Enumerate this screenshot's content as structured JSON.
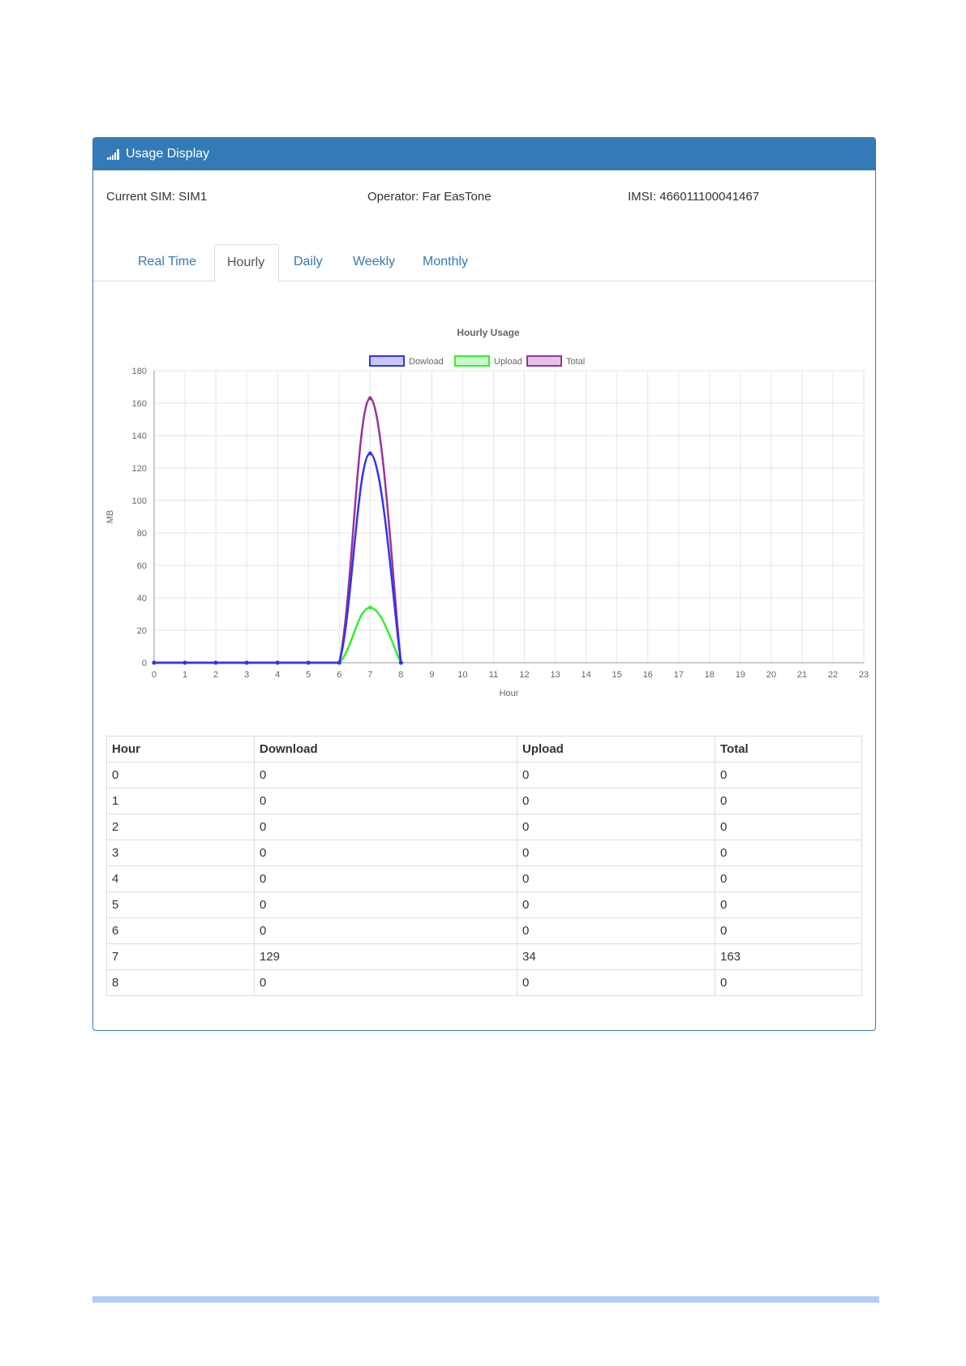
{
  "panel": {
    "title": "Usage Display",
    "icon": "signal-bars-icon",
    "current_sim": "Current SIM: SIM1",
    "operator": "Operator: Far EasTone",
    "imsi": "IMSI: 466011100041467"
  },
  "tabs": [
    {
      "label": "Real Time",
      "active": false
    },
    {
      "label": "Hourly",
      "active": true
    },
    {
      "label": "Daily",
      "active": false
    },
    {
      "label": "Weekly",
      "active": false
    },
    {
      "label": "Monthly",
      "active": false
    }
  ],
  "chart_data": {
    "type": "line",
    "title": "Hourly Usage",
    "xlabel": "Hour",
    "ylabel": "MB",
    "ylim": [
      0,
      180
    ],
    "yticks": [
      0,
      20,
      40,
      60,
      80,
      100,
      120,
      140,
      160,
      180
    ],
    "x": [
      0,
      1,
      2,
      3,
      4,
      5,
      6,
      7,
      8,
      9,
      10,
      11,
      12,
      13,
      14,
      15,
      16,
      17,
      18,
      19,
      20,
      21,
      22,
      23
    ],
    "legend_position": "top",
    "grid": true,
    "series": [
      {
        "name": "Dowload",
        "color": "#3333ee",
        "fill": "#c8c8f8",
        "values": [
          0,
          0,
          0,
          0,
          0,
          0,
          0,
          129,
          0
        ]
      },
      {
        "name": "Upload",
        "color": "#33ee33",
        "fill": "#c8f8c8",
        "values": [
          0,
          0,
          0,
          0,
          0,
          0,
          0,
          34,
          0
        ]
      },
      {
        "name": "Total",
        "color": "#993399",
        "fill": "#e6c3e6",
        "values": [
          0,
          0,
          0,
          0,
          0,
          0,
          0,
          163,
          0
        ]
      }
    ]
  },
  "table": {
    "headers": [
      "Hour",
      "Download",
      "Upload",
      "Total"
    ],
    "rows": [
      [
        "0",
        "0",
        "0",
        "0"
      ],
      [
        "1",
        "0",
        "0",
        "0"
      ],
      [
        "2",
        "0",
        "0",
        "0"
      ],
      [
        "3",
        "0",
        "0",
        "0"
      ],
      [
        "4",
        "0",
        "0",
        "0"
      ],
      [
        "5",
        "0",
        "0",
        "0"
      ],
      [
        "6",
        "0",
        "0",
        "0"
      ],
      [
        "7",
        "129",
        "34",
        "163"
      ],
      [
        "8",
        "0",
        "0",
        "0"
      ]
    ]
  }
}
